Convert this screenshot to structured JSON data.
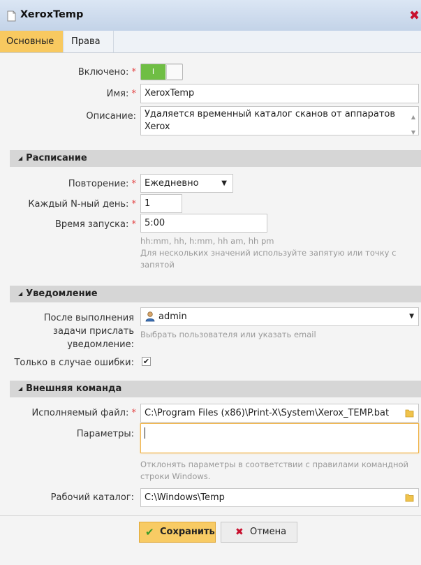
{
  "window": {
    "title": "XeroxTemp"
  },
  "tabs": [
    {
      "label": "Основные"
    },
    {
      "label": "Права"
    }
  ],
  "general": {
    "enabled_label": "Включено:",
    "toggle_on_text": "I",
    "name_label": "Имя:",
    "name_value": "XeroxTemp",
    "description_label": "Описание:",
    "description_line1": "Удаляется временный каталог сканов от аппаратов",
    "description_line2": "Xerox"
  },
  "schedule": {
    "section_title": "Расписание",
    "repeat_label": "Повторение:",
    "repeat_value": "Ежедневно",
    "every_n_label": "Каждый N-ный день:",
    "every_n_value": "1",
    "start_time_label": "Время запуска:",
    "start_time_value": "5:00",
    "hint_formats": "hh:mm, hh, h:mm, hh am, hh pm",
    "hint_line2": "Для нескольких значений используйте запятую или точку с",
    "hint_line3": "запятой"
  },
  "notification": {
    "section_title": "Уведомление",
    "send_label_line1": "После выполнения",
    "send_label_line2": "задачи прислать",
    "send_label_line3": "уведомление:",
    "recipient_value": "admin",
    "recipient_hint": "Выбрать пользователя или указать email",
    "errors_only_label": "Только в случае ошибки:",
    "errors_only_checked": true
  },
  "external_command": {
    "section_title": "Внешняя команда",
    "exe_label": "Исполняемый файл:",
    "exe_value": "C:\\Program Files (x86)\\Print-X\\System\\Xerox_TEMP.bat",
    "params_label": "Параметры:",
    "params_value": "",
    "params_hint_line1": "Отклонять параметры в соответствии с правилами командной",
    "params_hint_line2": "строки Windows.",
    "workdir_label": "Рабочий каталог:",
    "workdir_value": "C:\\Windows\\Temp"
  },
  "buttons": {
    "save": "Сохранить",
    "cancel": "Отмена"
  },
  "icons": {
    "title": "document-icon",
    "close": "close-icon",
    "user": "user-icon",
    "folder": "folder-icon",
    "save": "checkmark-icon",
    "cancel": "x-icon"
  },
  "colors": {
    "accent": "#f8c960",
    "toggle_on": "#6fbe44",
    "required": "#e34545",
    "close": "#c8102e"
  }
}
